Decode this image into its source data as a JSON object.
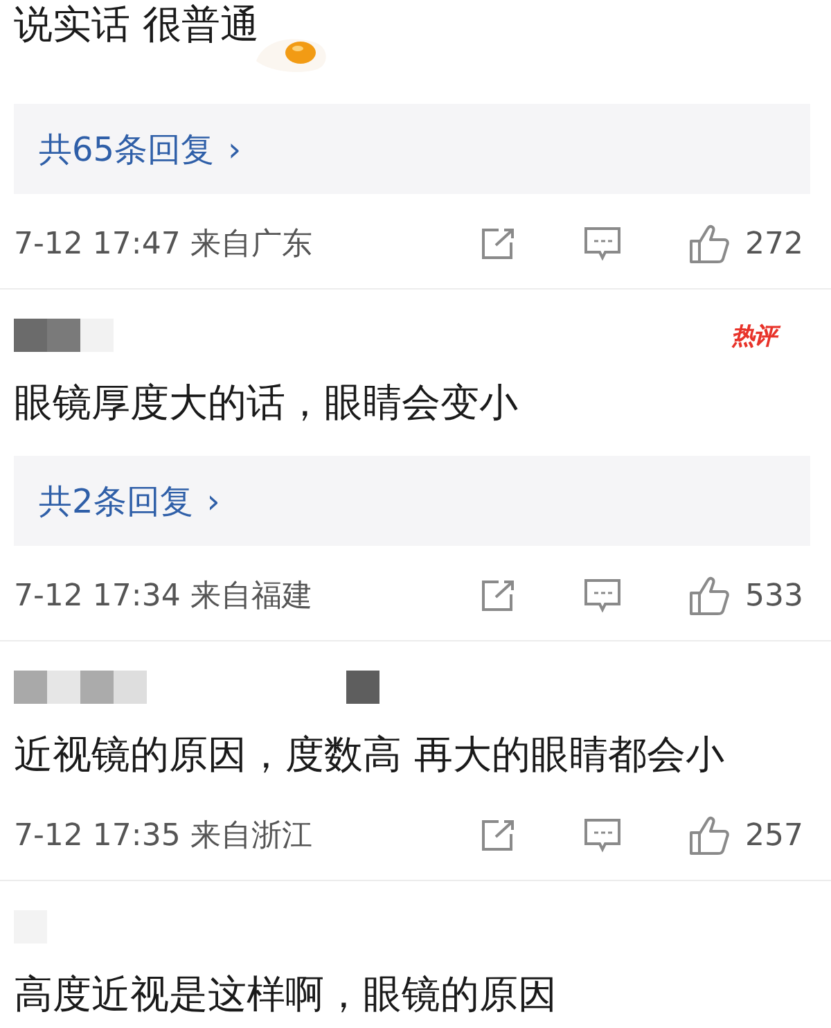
{
  "comments": [
    {
      "text": "说实话 很普通",
      "sticker": true,
      "replies": "共65条回复",
      "reply_arrow": "›",
      "time": "7-12 17:47",
      "location": "来自广东",
      "likes": "272"
    },
    {
      "badge": "热评",
      "text": "眼镜厚度大的话，眼睛会变小",
      "sticker": false,
      "replies": "共2条回复",
      "reply_arrow": "›",
      "time": "7-12 17:34",
      "location": "来自福建",
      "likes": "533"
    },
    {
      "text": "近视镜的原因，度数高 再大的眼睛都会小",
      "sticker": false,
      "time": "7-12 17:35",
      "location": "来自浙江",
      "likes": "257"
    },
    {
      "text": "高度近视是这样啊，眼镜的原因",
      "sticker": false
    }
  ]
}
